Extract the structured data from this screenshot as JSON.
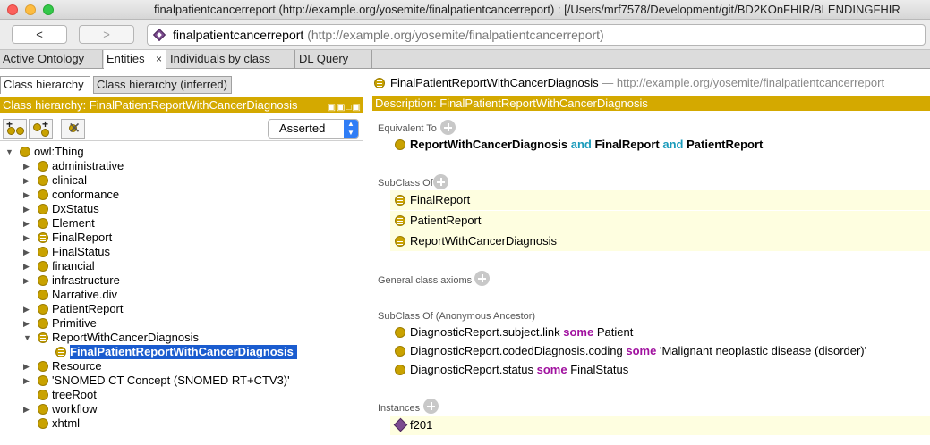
{
  "window": {
    "title": "finalpatientcancerreport (http://example.org/yosemite/finalpatientcancerreport)  : [/Users/mrf7578/Development/git/BD2KOnFHIR/BLENDINGFHIR"
  },
  "nav": {
    "back_label": "<",
    "forward_label": ">",
    "url_name": "finalpatientcancerreport",
    "url_uri": "(http://example.org/yosemite/finalpatientcancerreport)"
  },
  "tabs": [
    {
      "label": "Active Ontology"
    },
    {
      "label": "Entities",
      "close": "×"
    },
    {
      "label": "Individuals by class"
    },
    {
      "label": "DL Query"
    }
  ],
  "left": {
    "subtabs": [
      "Class hierarchy",
      "Class hierarchy (inferred)"
    ],
    "header": "Class hierarchy: FinalPatientReportWithCancerDiagnosis",
    "header_icons": "▣▣□▣",
    "select_value": "Asserted",
    "tree": [
      {
        "label": "owl:Thing",
        "depth": 0,
        "expand": "open",
        "def": false
      },
      {
        "label": "administrative",
        "depth": 1,
        "expand": "closed",
        "def": false
      },
      {
        "label": "clinical",
        "depth": 1,
        "expand": "closed",
        "def": false
      },
      {
        "label": "conformance",
        "depth": 1,
        "expand": "closed",
        "def": false
      },
      {
        "label": "DxStatus",
        "depth": 1,
        "expand": "closed",
        "def": false
      },
      {
        "label": "Element",
        "depth": 1,
        "expand": "closed",
        "def": false
      },
      {
        "label": "FinalReport",
        "depth": 1,
        "expand": "closed",
        "def": true
      },
      {
        "label": "FinalStatus",
        "depth": 1,
        "expand": "closed",
        "def": false
      },
      {
        "label": "financial",
        "depth": 1,
        "expand": "closed",
        "def": false
      },
      {
        "label": "infrastructure",
        "depth": 1,
        "expand": "closed",
        "def": false
      },
      {
        "label": "Narrative.div",
        "depth": 1,
        "expand": "none",
        "def": false
      },
      {
        "label": "PatientReport",
        "depth": 1,
        "expand": "closed",
        "def": false
      },
      {
        "label": "Primitive",
        "depth": 1,
        "expand": "closed",
        "def": false
      },
      {
        "label": "ReportWithCancerDiagnosis",
        "depth": 1,
        "expand": "open",
        "def": true
      },
      {
        "label": "FinalPatientReportWithCancerDiagnosis",
        "depth": 2,
        "expand": "none",
        "def": true,
        "selected": true
      },
      {
        "label": "Resource",
        "depth": 1,
        "expand": "closed",
        "def": false
      },
      {
        "label": "'SNOMED CT Concept (SNOMED RT+CTV3)'",
        "depth": 1,
        "expand": "closed",
        "def": false
      },
      {
        "label": "treeRoot",
        "depth": 1,
        "expand": "none",
        "def": false
      },
      {
        "label": "workflow",
        "depth": 1,
        "expand": "closed",
        "def": false
      },
      {
        "label": "xhtml",
        "depth": 1,
        "expand": "none",
        "def": false
      }
    ]
  },
  "right": {
    "title_name": "FinalPatientReportWithCancerDiagnosis",
    "title_uri": "— http://example.org/yosemite/finalpatientcancerreport",
    "desc_header": "Description: FinalPatientReportWithCancerDiagnosis",
    "equivalent_label": "Equivalent To",
    "equivalent": {
      "a": "ReportWithCancerDiagnosis",
      "and1": "and",
      "b": "FinalReport",
      "and2": "and",
      "c": "PatientReport"
    },
    "subclass_label": "SubClass Of",
    "subclass": [
      "FinalReport",
      "PatientReport",
      "ReportWithCancerDiagnosis"
    ],
    "gca_label": "General class axioms",
    "anon_label": "SubClass Of (Anonymous Ancestor)",
    "anon": [
      {
        "prop": "DiagnosticReport.subject.link",
        "kw": "some",
        "filler": "Patient"
      },
      {
        "prop": "DiagnosticReport.codedDiagnosis.coding",
        "kw": "some",
        "filler": "'Malignant neoplastic disease (disorder)'"
      },
      {
        "prop": "DiagnosticReport.status",
        "kw": "some",
        "filler": "FinalStatus"
      }
    ],
    "instances_label": "Instances",
    "instances": [
      "f201"
    ]
  },
  "colors": {
    "header_gold": "#d4a900",
    "class_ball": "#c9a200",
    "selection": "#1a5ccf",
    "kw_and": "#1a9bbb",
    "kw_some": "#a0119f",
    "highlight_row": "#fefee0"
  }
}
